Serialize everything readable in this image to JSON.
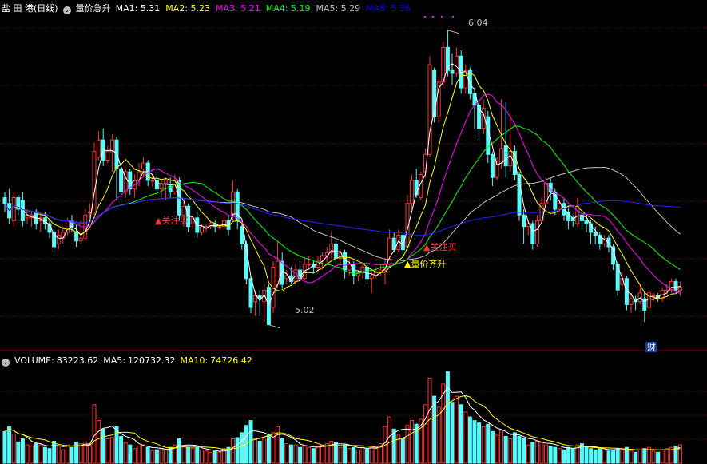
{
  "header": {
    "stock_name": "盐 田 港(日线)",
    "indicator_name": "量价急升",
    "ma": [
      {
        "label": "MA1:",
        "value": "5.31",
        "color": "#ffffff"
      },
      {
        "label": "MA2:",
        "value": "5.23",
        "color": "#ffff00"
      },
      {
        "label": "MA3:",
        "value": "5.21",
        "color": "#ff00ff"
      },
      {
        "label": "MA4:",
        "value": "5.19",
        "color": "#00ff00"
      },
      {
        "label": "MA5:",
        "value": "5.29",
        "color": "#c0c0c0"
      },
      {
        "label": "MA8:",
        "value": "5.36",
        "color": "#0000ff"
      }
    ]
  },
  "volume_header": {
    "title": "VOLUME:",
    "value": "83223.62",
    "ma5_label": "MA5:",
    "ma5_value": "120732.32",
    "ma10_label": "MA10:",
    "ma10_value": "74726.42"
  },
  "annotations": {
    "high_label": "6.04",
    "low_label": "5.02",
    "buy_signal_1": "▲关注买",
    "buy_signal_2": "▲关注买",
    "volume_signal": "▲量价齐升",
    "cai_badge": "财"
  },
  "colors": {
    "up": "#ff3232",
    "down": "#54fcfc",
    "grid": "#8b0000",
    "ma1": "#ffffff",
    "ma2": "#ffff00",
    "ma3": "#ff00ff",
    "ma4": "#00ff00",
    "ma5": "#c0c0c0",
    "ma8": "#2020ff"
  },
  "chart_data": {
    "type": "candlestick",
    "price_range": [
      4.95,
      6.1
    ],
    "volume_range": [
      0,
      160000
    ],
    "candles": [
      [
        5.46,
        5.44,
        5.48,
        5.41,
        52000
      ],
      [
        5.44,
        5.39,
        5.49,
        5.37,
        60000
      ],
      [
        5.38,
        5.46,
        5.48,
        5.36,
        48000
      ],
      [
        5.46,
        5.42,
        5.47,
        5.4,
        35000
      ],
      [
        5.45,
        5.38,
        5.48,
        5.36,
        40000
      ],
      [
        5.39,
        5.4,
        5.42,
        5.37,
        30000
      ],
      [
        5.39,
        5.4,
        5.41,
        5.36,
        28000
      ],
      [
        5.41,
        5.37,
        5.42,
        5.35,
        32000
      ],
      [
        5.38,
        5.39,
        5.4,
        5.34,
        30000
      ],
      [
        5.39,
        5.37,
        5.41,
        5.35,
        26000
      ],
      [
        5.37,
        5.34,
        5.38,
        5.32,
        24000
      ],
      [
        5.34,
        5.29,
        5.35,
        5.27,
        36000
      ],
      [
        5.3,
        5.33,
        5.35,
        5.28,
        28000
      ],
      [
        5.32,
        5.34,
        5.36,
        5.3,
        22000
      ],
      [
        5.34,
        5.38,
        5.39,
        5.33,
        30000
      ],
      [
        5.38,
        5.36,
        5.4,
        5.34,
        26000
      ],
      [
        5.34,
        5.31,
        5.37,
        5.29,
        34000
      ],
      [
        5.31,
        5.32,
        5.38,
        5.3,
        32000
      ],
      [
        5.32,
        5.4,
        5.42,
        5.31,
        35000
      ],
      [
        5.41,
        5.41,
        5.44,
        5.39,
        30000
      ],
      [
        5.41,
        5.62,
        5.65,
        5.4,
        96000
      ],
      [
        5.6,
        5.66,
        5.69,
        5.59,
        70000
      ],
      [
        5.66,
        5.59,
        5.7,
        5.57,
        56000
      ],
      [
        5.59,
        5.62,
        5.64,
        5.58,
        40000
      ],
      [
        5.62,
        5.66,
        5.68,
        5.55,
        42000
      ],
      [
        5.66,
        5.56,
        5.67,
        5.45,
        60000
      ],
      [
        5.56,
        5.48,
        5.57,
        5.45,
        44000
      ],
      [
        5.48,
        5.55,
        5.56,
        5.46,
        34000
      ],
      [
        5.55,
        5.49,
        5.56,
        5.47,
        30000
      ],
      [
        5.49,
        5.52,
        5.54,
        5.46,
        24000
      ],
      [
        5.52,
        5.55,
        5.58,
        5.5,
        28000
      ],
      [
        5.56,
        5.58,
        5.6,
        5.53,
        30000
      ],
      [
        5.58,
        5.52,
        5.59,
        5.5,
        26000
      ],
      [
        5.52,
        5.52,
        5.54,
        5.5,
        20000
      ],
      [
        5.52,
        5.49,
        5.55,
        5.47,
        22000
      ],
      [
        5.49,
        5.51,
        5.52,
        5.46,
        24000
      ],
      [
        5.51,
        5.52,
        5.53,
        5.45,
        22000
      ],
      [
        5.5,
        5.48,
        5.53,
        5.46,
        26000
      ],
      [
        5.48,
        5.52,
        5.54,
        5.47,
        30000
      ],
      [
        5.52,
        5.4,
        5.53,
        5.38,
        40000
      ],
      [
        5.4,
        5.43,
        5.45,
        5.36,
        28000
      ],
      [
        5.43,
        5.36,
        5.44,
        5.34,
        26000
      ],
      [
        5.37,
        5.39,
        5.4,
        5.35,
        24000
      ],
      [
        5.39,
        5.34,
        5.41,
        5.32,
        26000
      ],
      [
        5.34,
        5.36,
        5.37,
        5.33,
        22000
      ],
      [
        5.36,
        5.36,
        5.37,
        5.34,
        20000
      ],
      [
        5.36,
        5.37,
        5.38,
        5.35,
        18000
      ],
      [
        5.37,
        5.36,
        5.38,
        5.34,
        20000
      ],
      [
        5.36,
        5.36,
        5.37,
        5.35,
        18000
      ],
      [
        5.36,
        5.38,
        5.4,
        5.35,
        24000
      ],
      [
        5.38,
        5.35,
        5.4,
        5.33,
        26000
      ],
      [
        5.4,
        5.48,
        5.52,
        5.38,
        40000
      ],
      [
        5.48,
        5.38,
        5.49,
        5.35,
        42000
      ],
      [
        5.36,
        5.3,
        5.37,
        5.28,
        50000
      ],
      [
        5.3,
        5.18,
        5.31,
        5.16,
        62000
      ],
      [
        5.18,
        5.08,
        5.19,
        5.06,
        70000
      ],
      [
        5.1,
        5.12,
        5.14,
        5.05,
        40000
      ],
      [
        5.12,
        5.11,
        5.14,
        5.05,
        36000
      ],
      [
        5.1,
        5.14,
        5.16,
        5.03,
        42000
      ],
      [
        5.15,
        5.02,
        5.16,
        5.02,
        46000
      ],
      [
        5.08,
        5.22,
        5.24,
        5.06,
        50000
      ],
      [
        5.16,
        5.24,
        5.31,
        5.15,
        60000
      ],
      [
        5.24,
        5.16,
        5.27,
        5.14,
        40000
      ],
      [
        5.18,
        5.19,
        5.21,
        5.16,
        32000
      ],
      [
        5.19,
        5.17,
        5.22,
        5.16,
        30000
      ],
      [
        5.17,
        5.21,
        5.23,
        5.16,
        30000
      ],
      [
        5.21,
        5.18,
        5.24,
        5.17,
        26000
      ],
      [
        5.18,
        5.23,
        5.25,
        5.17,
        28000
      ],
      [
        5.23,
        5.23,
        5.26,
        5.21,
        26000
      ],
      [
        5.23,
        5.22,
        5.24,
        5.2,
        24000
      ],
      [
        5.22,
        5.24,
        5.26,
        5.2,
        28000
      ],
      [
        5.24,
        5.26,
        5.27,
        5.21,
        30000
      ],
      [
        5.26,
        5.27,
        5.29,
        5.23,
        32000
      ],
      [
        5.27,
        5.3,
        5.34,
        5.25,
        36000
      ],
      [
        5.3,
        5.25,
        5.32,
        5.23,
        34000
      ],
      [
        5.25,
        5.27,
        5.28,
        5.23,
        26000
      ],
      [
        5.27,
        5.21,
        5.28,
        5.18,
        30000
      ],
      [
        5.21,
        5.23,
        5.25,
        5.19,
        24000
      ],
      [
        5.23,
        5.19,
        5.24,
        5.16,
        26000
      ],
      [
        5.19,
        5.2,
        5.21,
        5.17,
        22000
      ],
      [
        5.2,
        5.22,
        5.23,
        5.18,
        26000
      ],
      [
        5.22,
        5.18,
        5.23,
        5.16,
        24000
      ],
      [
        5.18,
        5.19,
        5.21,
        5.13,
        28000
      ],
      [
        5.19,
        5.2,
        5.22,
        5.18,
        24000
      ],
      [
        5.2,
        5.21,
        5.23,
        5.19,
        32000
      ],
      [
        5.21,
        5.23,
        5.25,
        5.16,
        60000
      ],
      [
        5.23,
        5.32,
        5.35,
        5.22,
        76000
      ],
      [
        5.32,
        5.28,
        5.34,
        5.27,
        56000
      ],
      [
        5.28,
        5.33,
        5.35,
        5.27,
        46000
      ],
      [
        5.33,
        5.28,
        5.34,
        5.26,
        40000
      ],
      [
        5.29,
        5.44,
        5.47,
        5.28,
        62000
      ],
      [
        5.44,
        5.52,
        5.54,
        5.42,
        70000
      ],
      [
        5.52,
        5.47,
        5.56,
        5.46,
        64000
      ],
      [
        5.46,
        5.54,
        5.55,
        5.45,
        72000
      ],
      [
        5.55,
        5.61,
        5.63,
        5.53,
        96000
      ],
      [
        5.61,
        5.92,
        5.95,
        5.6,
        140000
      ],
      [
        5.9,
        5.74,
        5.91,
        5.72,
        110000
      ],
      [
        5.74,
        5.86,
        5.88,
        5.72,
        92000
      ],
      [
        5.86,
        5.98,
        6.0,
        5.84,
        130000
      ],
      [
        5.98,
        5.9,
        6.04,
        5.88,
        150000
      ],
      [
        5.9,
        5.89,
        5.96,
        5.85,
        100000
      ],
      [
        5.89,
        5.95,
        5.98,
        5.88,
        110000
      ],
      [
        5.95,
        5.84,
        5.97,
        5.82,
        96000
      ],
      [
        5.84,
        5.9,
        5.92,
        5.82,
        84000
      ],
      [
        5.9,
        5.82,
        5.91,
        5.8,
        76000
      ],
      [
        5.82,
        5.78,
        5.84,
        5.7,
        70000
      ],
      [
        5.78,
        5.7,
        5.8,
        5.66,
        66000
      ],
      [
        5.7,
        5.77,
        5.8,
        5.68,
        60000
      ],
      [
        5.74,
        5.61,
        5.76,
        5.58,
        64000
      ],
      [
        5.61,
        5.53,
        5.62,
        5.5,
        52000
      ],
      [
        5.53,
        5.58,
        5.6,
        5.52,
        46000
      ],
      [
        5.58,
        5.63,
        5.8,
        5.56,
        54000
      ],
      [
        5.64,
        5.57,
        5.79,
        5.53,
        44000
      ],
      [
        5.57,
        5.62,
        5.75,
        5.55,
        40000
      ],
      [
        5.62,
        5.54,
        5.64,
        5.52,
        50000
      ],
      [
        5.54,
        5.4,
        5.55,
        5.38,
        44000
      ],
      [
        5.4,
        5.36,
        5.42,
        5.3,
        40000
      ],
      [
        5.36,
        5.37,
        5.38,
        5.33,
        30000
      ],
      [
        5.37,
        5.3,
        5.38,
        5.28,
        34000
      ],
      [
        5.3,
        5.38,
        5.4,
        5.29,
        36000
      ],
      [
        5.38,
        5.44,
        5.46,
        5.37,
        34000
      ],
      [
        5.44,
        5.51,
        5.53,
        5.43,
        30000
      ],
      [
        5.51,
        5.48,
        5.53,
        5.45,
        28000
      ],
      [
        5.48,
        5.42,
        5.49,
        5.4,
        26000
      ],
      [
        5.42,
        5.44,
        5.45,
        5.41,
        24000
      ],
      [
        5.44,
        5.4,
        5.46,
        5.38,
        22000
      ],
      [
        5.41,
        5.38,
        5.43,
        5.35,
        26000
      ],
      [
        5.39,
        5.38,
        5.4,
        5.36,
        24000
      ],
      [
        5.37,
        5.43,
        5.46,
        5.36,
        30000
      ],
      [
        5.4,
        5.38,
        5.41,
        5.35,
        32000
      ],
      [
        5.38,
        5.37,
        5.39,
        5.34,
        26000
      ],
      [
        5.37,
        5.34,
        5.38,
        5.3,
        24000
      ],
      [
        5.34,
        5.33,
        5.36,
        5.3,
        22000
      ],
      [
        5.33,
        5.3,
        5.34,
        5.28,
        24000
      ],
      [
        5.3,
        5.32,
        5.33,
        5.29,
        22000
      ],
      [
        5.32,
        5.29,
        5.33,
        5.27,
        20000
      ],
      [
        5.29,
        5.23,
        5.3,
        5.21,
        22000
      ],
      [
        5.23,
        5.14,
        5.24,
        5.12,
        24000
      ],
      [
        5.16,
        5.18,
        5.2,
        5.14,
        22000
      ],
      [
        5.18,
        5.09,
        5.19,
        5.07,
        26000
      ],
      [
        5.09,
        5.11,
        5.13,
        5.06,
        20000
      ],
      [
        5.11,
        5.1,
        5.12,
        5.07,
        18000
      ],
      [
        5.1,
        5.13,
        5.16,
        5.09,
        22000
      ],
      [
        5.11,
        5.07,
        5.13,
        5.03,
        24000
      ],
      [
        5.08,
        5.13,
        5.14,
        5.06,
        26000
      ],
      [
        5.12,
        5.12,
        5.13,
        5.1,
        20000
      ],
      [
        5.12,
        5.11,
        5.13,
        5.1,
        18000
      ],
      [
        5.11,
        5.14,
        5.15,
        5.1,
        22000
      ],
      [
        5.14,
        5.14,
        5.16,
        5.12,
        24000
      ],
      [
        5.14,
        5.17,
        5.18,
        5.13,
        26000
      ],
      [
        5.17,
        5.14,
        5.18,
        5.13,
        28000
      ],
      [
        5.14,
        5.15,
        5.17,
        5.12,
        30000
      ]
    ]
  }
}
